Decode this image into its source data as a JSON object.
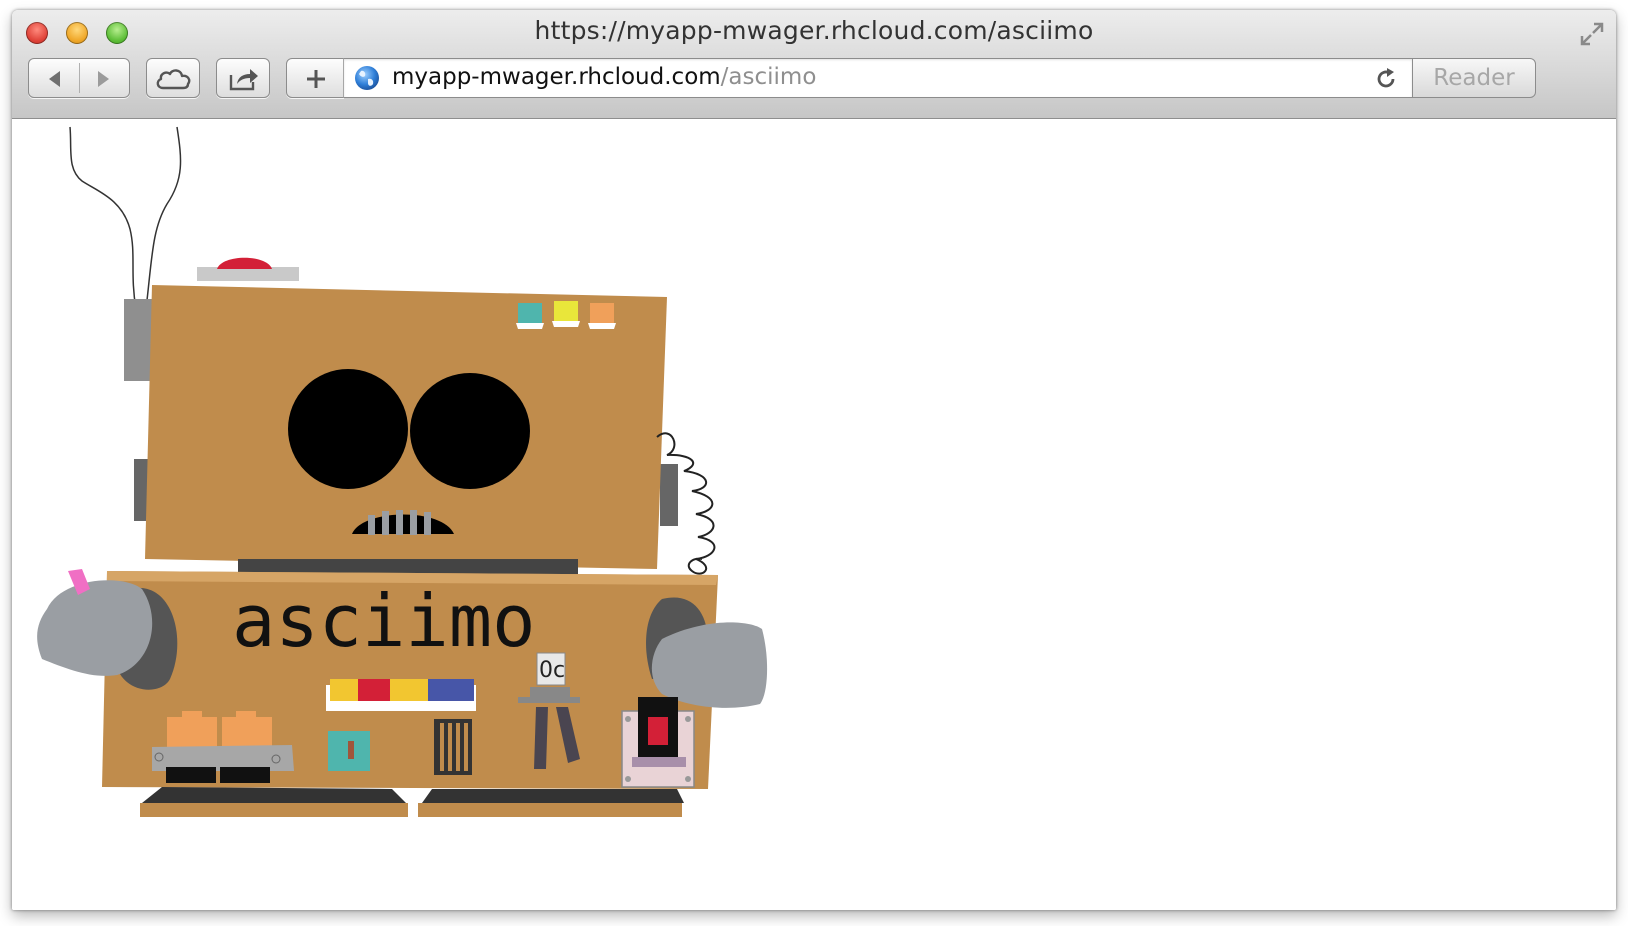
{
  "window": {
    "title": "https://myapp-mwager.rhcloud.com/asciimo"
  },
  "toolbar": {
    "back_icon": "back-arrow-icon",
    "forward_icon": "forward-arrow-icon",
    "icloud_icon": "cloud-icon",
    "share_icon": "share-icon",
    "new_tab_icon": "plus-icon",
    "reader_label": "Reader"
  },
  "address": {
    "domain": "myapp-mwager.rhcloud.com",
    "path": "/asciimo"
  },
  "page": {
    "robot_name": "asciimo",
    "gauge_label": "0c"
  },
  "colors": {
    "robot_body": "#c08c4c",
    "eyes": "#000000",
    "button_red": "#d32037",
    "arm_gray": "#9a9ea3"
  }
}
